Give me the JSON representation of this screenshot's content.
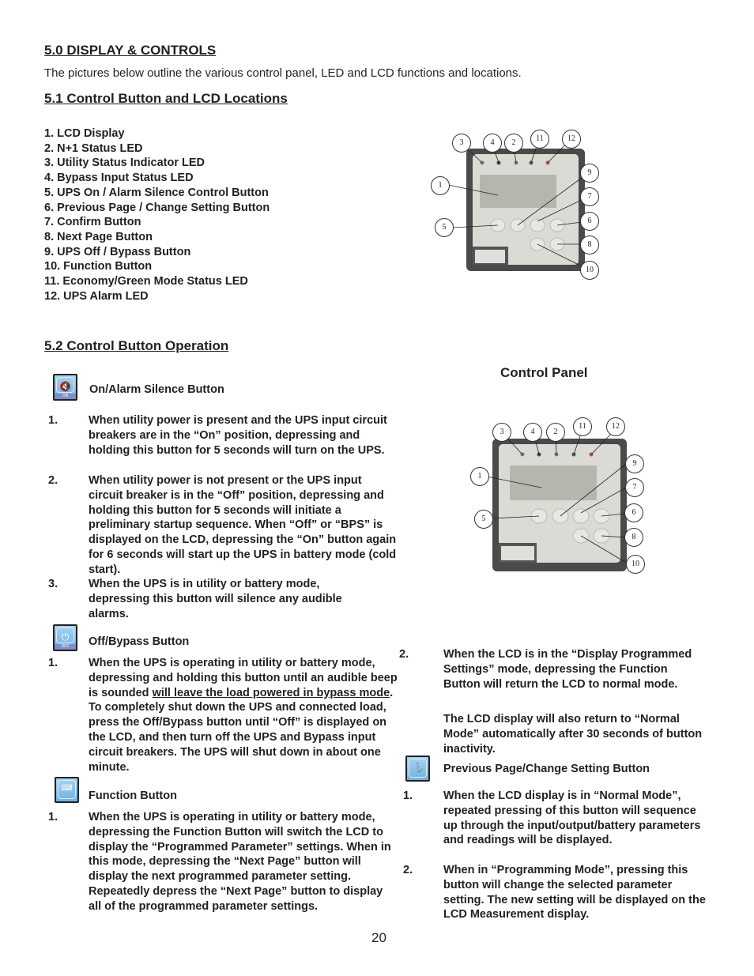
{
  "section_title": "5.0 DISPLAY & CONTROLS",
  "intro": "The pictures below outline the various control panel, LED and LCD functions and locations.",
  "locations": {
    "heading": "5.1 Control Button and LCD Locations",
    "items": [
      "1. LCD Display",
      "2. N+1 Status LED",
      "3. Utility Status Indicator LED",
      "4. Bypass Input Status LED",
      "5. UPS On / Alarm Silence Control Button",
      "6. Previous Page / Change Setting Button",
      "7. Confirm Button",
      "8. Next Page Button",
      "9. UPS Off / Bypass Button",
      "10. Function Button",
      "11. Economy/Green Mode Status LED",
      "12. UPS Alarm LED"
    ],
    "callouts": [
      "3",
      "4",
      "2",
      "11",
      "12",
      "1",
      "9",
      "7",
      "5",
      "6",
      "8",
      "10"
    ]
  },
  "operation": {
    "heading": "5.2 Control Button Operation",
    "panel_caption": "Control Panel",
    "on_button": {
      "icon": "speaker-mute-icon",
      "icon_label": "ON",
      "title": "On/Alarm Silence Button",
      "items": [
        {
          "num": "1.",
          "text": "When utility power is present and the UPS input circuit breakers are in the “On” position, depressing and holding this button for 5 seconds will turn on the UPS."
        },
        {
          "num": "2.",
          "text": "When utility power is not present or the UPS input circuit breaker is in the “Off” position, depressing and holding this button for 5 seconds will initiate a preliminary startup sequence. When “Off” or “BPS” is displayed on the LCD, depressing the “On” button  again for 6 seconds will start up the UPS in battery mode (cold start)."
        },
        {
          "num": "3.",
          "text": "When the UPS is in utility or battery mode, depressing this button will silence any audible alarms."
        }
      ]
    },
    "off_button": {
      "icon": "power-icon",
      "icon_label": "OFF",
      "title": "Off/Bypass Button",
      "item_num": "1.",
      "text_before": "When the UPS is operating in utility or battery mode, depressing and holding this button until an audible beep is sounded ",
      "text_underlined": "will leave the load powered in bypass mode",
      "text_after": ". To completely shut down the UPS and connected load,  press the Off/Bypass button until “Off” is displayed on the LCD, and then turn off the UPS and Bypass input circuit breakers. The UPS will shut down in about one minute."
    },
    "function_button": {
      "icon": "function-key-icon",
      "title": "Function Button",
      "items": [
        {
          "num": "1.",
          "text": "When the UPS is operating in utility or battery mode, depressing the Function Button will switch the LCD to display the “Programmed Parameter” settings. When in this mode, depressing the “Next Page” button will display the next programmed parameter setting. Repeatedly depress the “Next Page” button to display all of the programmed parameter settings."
        },
        {
          "num": "2.",
          "text": "When the LCD is in the “Display Programmed Settings” mode, depressing the Function Button will return the LCD to normal mode."
        }
      ],
      "note": "The LCD display will also return to “Normal Mode” automatically after 30 seconds of button inactivity."
    },
    "prev_button": {
      "icon": "up-arrow-icon",
      "title": "Previous Page/Change Setting Button",
      "items": [
        {
          "num": "1.",
          "text": "When the LCD display is in “Normal Mode”, repeated pressing of this button will sequence up through the input/output/battery parameters and readings will be displayed."
        },
        {
          "num": "2.",
          "text": "When  in “Programming Mode”, pressing this button will change the selected parameter setting. The new setting will be displayed on the LCD Measurement display."
        }
      ]
    }
  },
  "page_number": "20"
}
